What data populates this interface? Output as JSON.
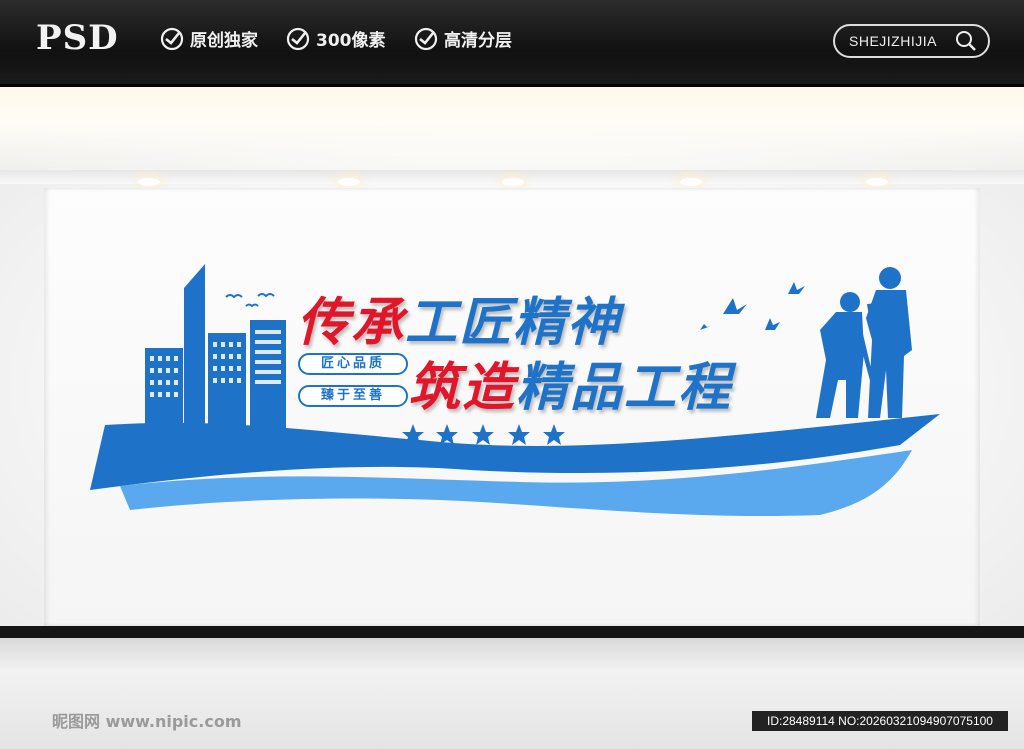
{
  "header": {
    "brand": "PSD",
    "badges": [
      "原创独家",
      "300像素",
      "高清分层"
    ],
    "search_text": "SHEJIZHIJIA"
  },
  "mural": {
    "headline_line1_red": "传承",
    "headline_line1_blue": "工匠精神",
    "headline_line2_red": "筑造",
    "headline_line2_blue": "精品工程",
    "tag_top": "匠心品质",
    "tag_bottom": "臻于至善",
    "colors": {
      "red": "#e1162a",
      "blue": "#1e73c8"
    }
  },
  "footer": {
    "watermark": "昵图网 www.nipic.com",
    "id_text": "ID:28489114 NO:20260321094907075100"
  }
}
